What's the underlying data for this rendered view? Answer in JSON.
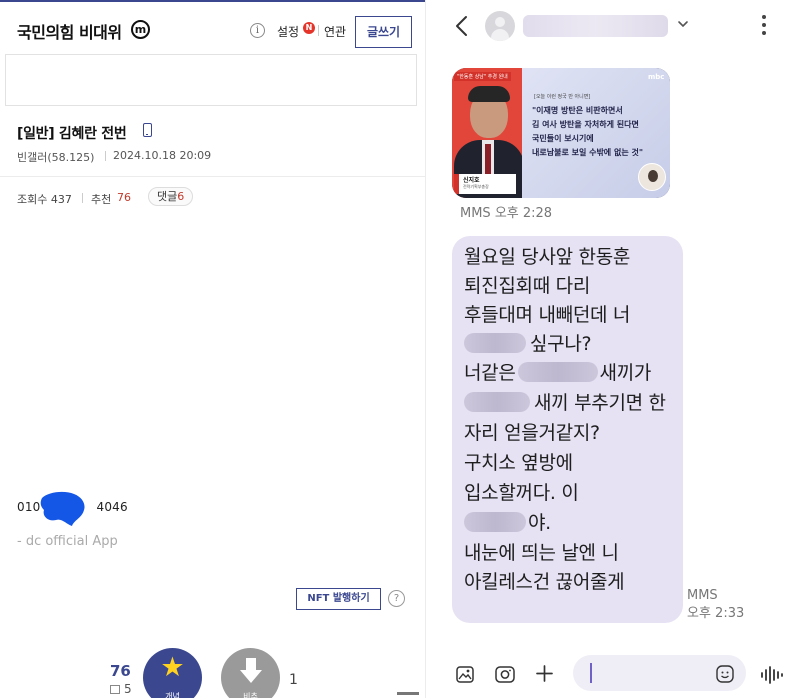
{
  "left": {
    "gallery_title": "국민의힘 비대위",
    "minor_badge": "m",
    "info_glyph": "i",
    "setting_label": "설정",
    "new_badge": "N",
    "related_label": "연관",
    "write_button": "글쓰기",
    "post": {
      "title": "[일반] 김혜란 전번",
      "author": "빈갤러(58.125)",
      "date": "2024.10.18 20:09",
      "views_label": "조회수 437",
      "recommend_label": "추천",
      "recommend_value": "76",
      "comment_label": "댓글",
      "comment_value": "6",
      "phone_prefix": "010",
      "phone_suffix": "4046",
      "app_signature": "- dc official App"
    },
    "nft_button": "NFT 발행하기",
    "help_glyph": "?",
    "vote": {
      "up_count": "76",
      "fixed_count": "5",
      "up_label": "개념",
      "down_label": "비추",
      "down_count": "1"
    },
    "colors": {
      "accent": "#3b4890",
      "recommend": "#c0392b",
      "new_badge": "#e5352b"
    }
  },
  "right": {
    "thumbnail": {
      "tag": "\"한동훈 상남\" 추경 원내",
      "subhead": "[오늘 이런 정국 만 아니면]",
      "logo": "mbc",
      "quote_lines": [
        "\"이재명 방탄은 비판하면서",
        "김 여사 방탄을 자처하게 된다면",
        "국민들이 보시기에",
        "내로남불로 보일 수밖에 없는 것\""
      ],
      "person_name": "신지호",
      "person_role": "전략기획부총장"
    },
    "mms_meta1": "MMS 오후 2:28",
    "message": [
      "월요일 당사앞 한동훈",
      "퇴진집회때 다리",
      "후들대며 내빼던데 너",
      "싶구나?",
      "너같은",
      "새끼가",
      "새끼 부추기면 한",
      "자리 얻을거같지?",
      "구치소 옆방에",
      "입소할꺼다. 이",
      "야.",
      "내눈에 띄는 날엔 니",
      "아킬레스건 끊어줄게"
    ],
    "mms_meta2_line1": "MMS",
    "mms_meta2_line2": "오후 2:33",
    "colors": {
      "bubble": "#e6e1f3",
      "caret": "#6e62c7"
    }
  }
}
